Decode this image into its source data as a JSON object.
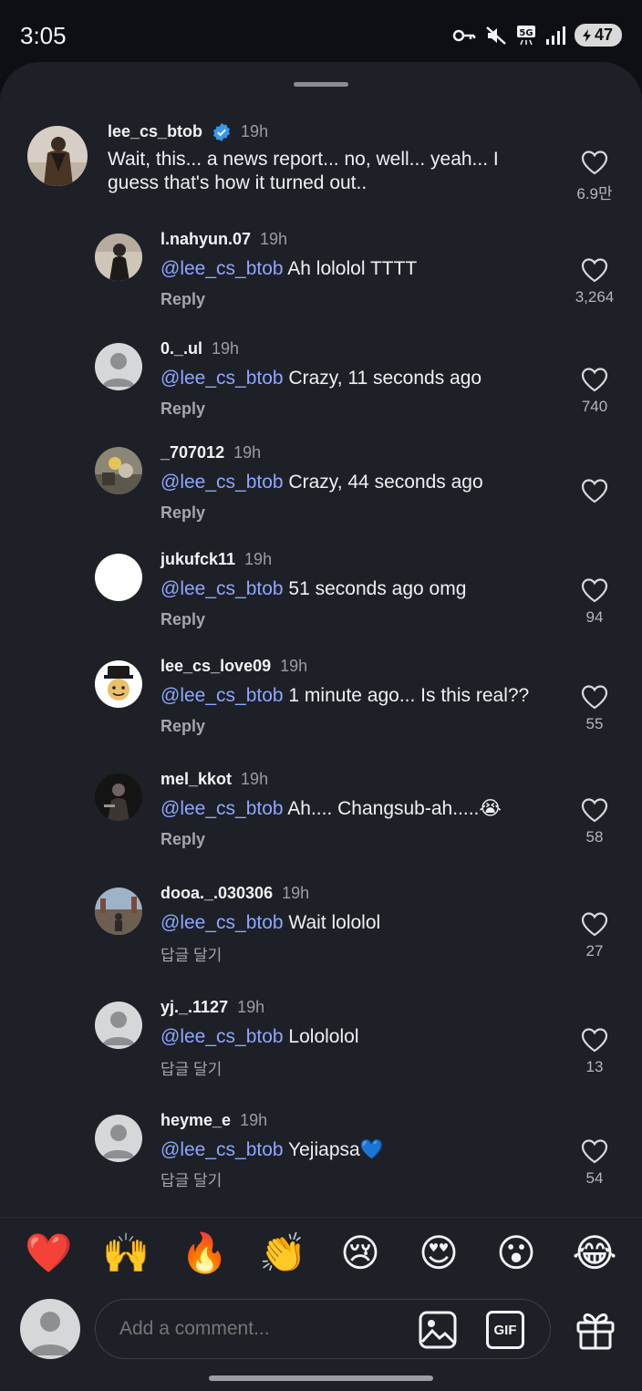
{
  "status_bar": {
    "time": "3:05",
    "battery": "47"
  },
  "post_comment": {
    "username": "lee_cs_btob",
    "time": "19h",
    "text": "Wait, this... a news report... no, well... yeah... I guess that's how it turned out..",
    "likes": "6.9만"
  },
  "replies": [
    {
      "username": "l.nahyun.07",
      "time": "19h",
      "mention": "@lee_cs_btob",
      "text": "Ah lololol TTTT",
      "reply_label": "Reply",
      "likes": "3,264"
    },
    {
      "username": "0._.ul",
      "time": "19h",
      "mention": "@lee_cs_btob",
      "text": "Crazy, 11 seconds ago",
      "reply_label": "Reply",
      "likes": "740"
    },
    {
      "username": "_707012",
      "time": "19h",
      "mention": "@lee_cs_btob",
      "text": "Crazy, 44 seconds ago",
      "reply_label": "Reply",
      "likes": ""
    },
    {
      "username": "jukufck11",
      "time": "19h",
      "mention": "@lee_cs_btob",
      "text": "51 seconds ago omg",
      "reply_label": "Reply",
      "likes": "94"
    },
    {
      "username": "lee_cs_love09",
      "time": "19h",
      "mention": "@lee_cs_btob",
      "text": "1 minute ago... Is this real??",
      "reply_label": "Reply",
      "likes": "55"
    },
    {
      "username": "mel_kkot",
      "time": "19h",
      "mention": "@lee_cs_btob",
      "text": "Ah.... Changsub-ah.....😭",
      "reply_label": "Reply",
      "likes": "58"
    },
    {
      "username": "dooa._.030306",
      "time": "19h",
      "mention": "@lee_cs_btob",
      "text": "Wait lololol",
      "reply_label": "답글 달기",
      "likes": "27"
    },
    {
      "username": "yj._.1127",
      "time": "19h",
      "mention": "@lee_cs_btob",
      "text": "Lolololol",
      "reply_label": "답글 달기",
      "likes": "13"
    },
    {
      "username": "heyme_e",
      "time": "19h",
      "mention": "@lee_cs_btob",
      "text": "Yejiapsa💙",
      "reply_label": "답글 달기",
      "likes": "54"
    }
  ],
  "quick_emojis": [
    "❤️",
    "🙌",
    "🔥",
    "👏",
    "😢",
    "😍",
    "😮",
    "😂"
  ],
  "composer": {
    "placeholder": "Add a comment...",
    "gif_label": "GIF"
  },
  "colors": {
    "sheet_bg": "#1d2026",
    "mention": "#8ea6ff",
    "verified": "#3897f0"
  }
}
